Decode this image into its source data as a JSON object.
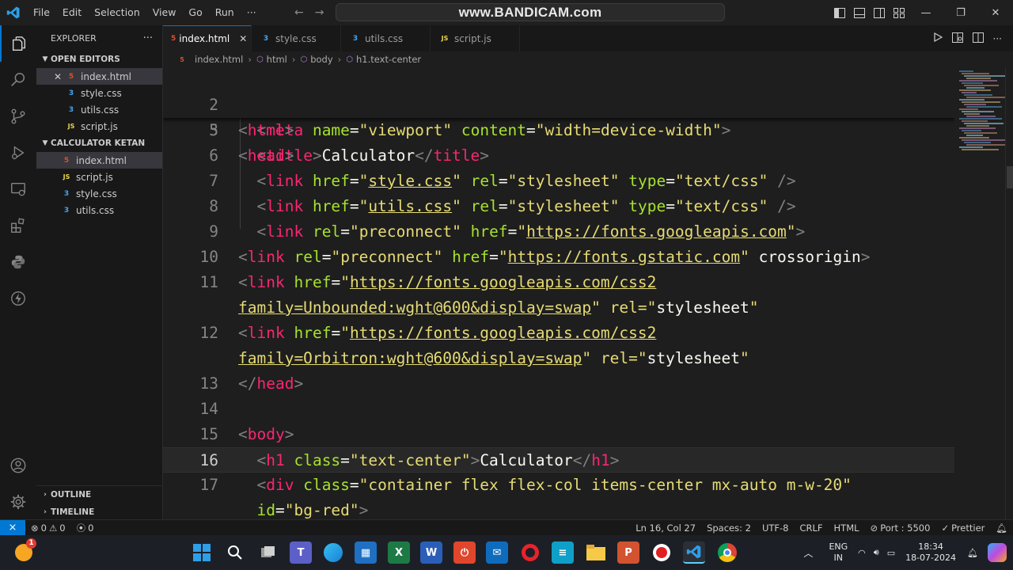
{
  "titlebar": {
    "menu": [
      "File",
      "Edit",
      "Selection",
      "View",
      "Go",
      "Run",
      "···"
    ],
    "command_center": "www.BANDICAM.com"
  },
  "sidebar": {
    "title": "EXPLORER",
    "more": "···",
    "open_editors": {
      "label": "OPEN EDITORS",
      "items": [
        {
          "name": "index.html",
          "type": "HTML"
        },
        {
          "name": "style.css",
          "type": "CSS"
        },
        {
          "name": "utils.css",
          "type": "CSS"
        },
        {
          "name": "script.js",
          "type": "JS"
        }
      ]
    },
    "folder": {
      "label": "CALCULATOR KETAN",
      "items": [
        {
          "name": "index.html",
          "type": "HTML"
        },
        {
          "name": "script.js",
          "type": "JS"
        },
        {
          "name": "style.css",
          "type": "CSS"
        },
        {
          "name": "utils.css",
          "type": "CSS"
        }
      ]
    },
    "outline": "OUTLINE",
    "timeline": "TIMELINE"
  },
  "tabs": [
    {
      "label": "index.html",
      "icon": "HTML",
      "active": true
    },
    {
      "label": "style.css",
      "icon": "CSS"
    },
    {
      "label": "utils.css",
      "icon": "CSS"
    },
    {
      "label": "script.js",
      "icon": "JS"
    }
  ],
  "breadcrumb": [
    "index.html",
    "html",
    "body",
    "h1.text-center"
  ],
  "editor": {
    "sticky": [
      {
        "n": "2",
        "code": "<html>"
      },
      {
        "n": "3",
        "code": "<head>"
      }
    ],
    "lines": [
      {
        "n": "5",
        "code": "  <meta name=\"viewport\" content=\"width=device-width\">"
      },
      {
        "n": "6",
        "code": "  <title>Calculator</title>"
      },
      {
        "n": "7",
        "code": "  <link href=\"style.css\" rel=\"stylesheet\" type=\"text/css\" />"
      },
      {
        "n": "8",
        "code": "  <link href=\"utils.css\" rel=\"stylesheet\" type=\"text/css\" />"
      },
      {
        "n": "9",
        "code": "  <link rel=\"preconnect\" href=\"https://fonts.googleapis.com\">"
      },
      {
        "n": "10",
        "code": "<link rel=\"preconnect\" href=\"https://fonts.gstatic.com\" crossorigin>"
      },
      {
        "n": "11",
        "code": "<link href=\"https://fonts.googleapis.com/css2?"
      },
      {
        "n": "",
        "code": "family=Unbounded:wght@600&display=swap\" rel=\"stylesheet\">"
      },
      {
        "n": "12",
        "code": "<link href=\"https://fonts.googleapis.com/css2?"
      },
      {
        "n": "",
        "code": "family=Orbitron:wght@600&display=swap\" rel=\"stylesheet\">"
      },
      {
        "n": "13",
        "code": "</head>"
      },
      {
        "n": "14",
        "code": ""
      },
      {
        "n": "15",
        "code": "<body>"
      },
      {
        "n": "16",
        "code": "  <h1 class=\"text-center\">Calculator</h1>",
        "current": true
      },
      {
        "n": "17",
        "code": "  <div class=\"container flex flex-col items-center mx-auto m-w-20\""
      },
      {
        "n": "",
        "code": "  id=\"bg-red\">"
      }
    ]
  },
  "statusbar": {
    "errors": "0",
    "warnings": "0",
    "ports": "0",
    "position": "Ln 16, Col 27",
    "spaces": "Spaces: 2",
    "encoding": "UTF-8",
    "eol": "CRLF",
    "language": "HTML",
    "port": "Port : 5500",
    "formatter": "Prettier"
  },
  "taskbar": {
    "notification_badge": "1",
    "lang_top": "ENG",
    "lang_bottom": "IN",
    "time": "18:34",
    "date": "18-07-2024"
  },
  "colors": {
    "accent": "#0078d4",
    "html_icon": "#e44d26",
    "css_icon": "#42a5f5",
    "js_icon": "#e8d44d"
  }
}
